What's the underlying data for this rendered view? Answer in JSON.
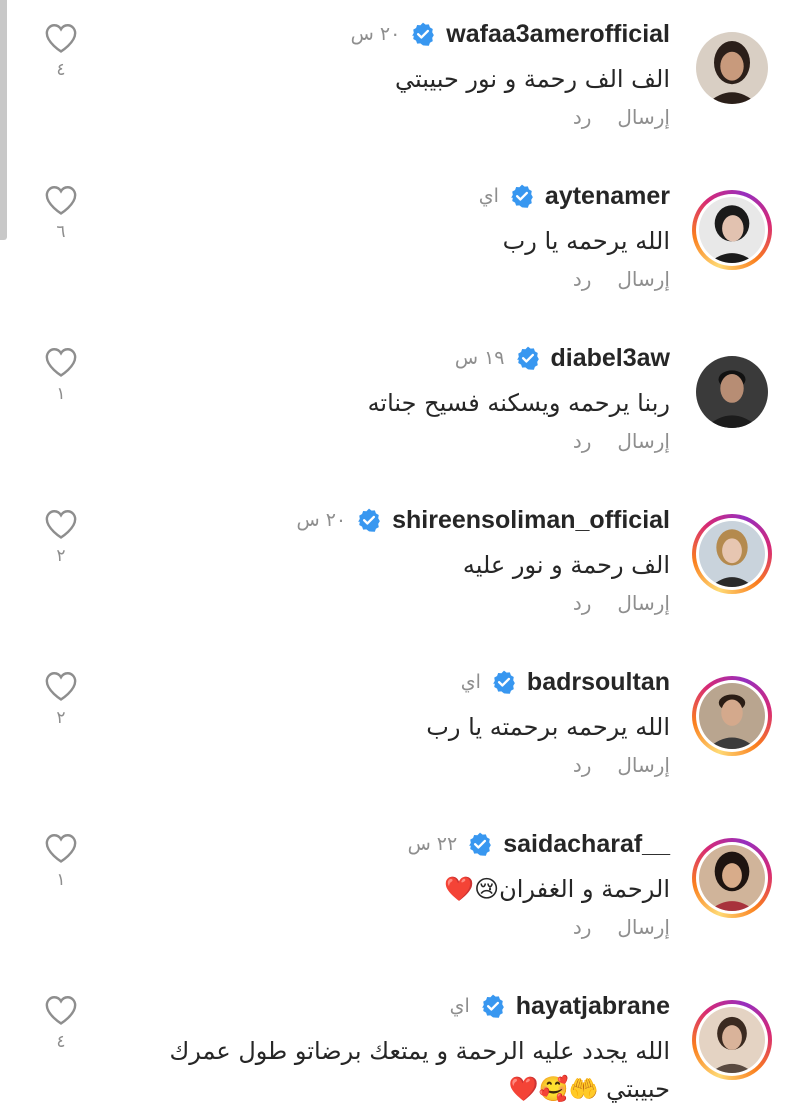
{
  "actions": {
    "reply": "رد",
    "send": "إرسال"
  },
  "colors": {
    "verified": "#3897f0",
    "story_ring": "#d62976",
    "secondary_text": "#8e8e8e"
  },
  "comments": [
    {
      "username": "wafaa3amerofficial",
      "time": "٢٠ س",
      "text": "الف الف رحمة و نور حبيبتي",
      "likes": "٤",
      "story_ring": false,
      "avatar_bg": "#d9cfc4",
      "avatar_hair": "#2b1f19",
      "avatar_skin": "#c89a7c"
    },
    {
      "username": "aytenamer",
      "time": "اي",
      "text": "الله يرحمه يا رب",
      "likes": "٦",
      "story_ring": true,
      "avatar_bg": "#e8e8e8",
      "avatar_hair": "#1a1a1a",
      "avatar_skin": "#e2c2b0"
    },
    {
      "username": "diabel3aw",
      "time": "١٩ س",
      "text": "ربنا يرحمه ويسكنه فسيح جناته",
      "likes": "١",
      "story_ring": false,
      "avatar_bg": "#3a3a3a",
      "avatar_hair": "#111111",
      "avatar_skin": "#b78d74"
    },
    {
      "username": "shireensoliman_official",
      "time": "٢٠ س",
      "text": "الف رحمة و نور عليه",
      "likes": "٢",
      "story_ring": true,
      "avatar_bg": "#c9d3dc",
      "avatar_hair": "#b48a4e",
      "avatar_skin": "#e7c6b1"
    },
    {
      "username": "badrsoultan",
      "time": "اي",
      "text": "الله يرحمه برحمته يا رب",
      "likes": "٢",
      "story_ring": true,
      "avatar_bg": "#b9a58f",
      "avatar_hair": "#2a1d15",
      "avatar_skin": "#d4a98c"
    },
    {
      "username": "saidacharaf__",
      "time": "٢٢ س",
      "text": "الرحمة و الغفران😢❤️",
      "likes": "١",
      "story_ring": true,
      "avatar_bg": "#d0b49a",
      "avatar_hair": "#1e1410",
      "avatar_skin": "#d8ac8a"
    },
    {
      "username": "hayatjabrane",
      "time": "اي",
      "text": "الله يجدد عليه الرحمة و يمتعك برضاتو طول عمرك حبيبتي 🤲🥰❤️",
      "likes": "٤",
      "story_ring": true,
      "avatar_bg": "#e4d3c3",
      "avatar_hair": "#3b2a20",
      "avatar_skin": "#d9b39a"
    }
  ]
}
